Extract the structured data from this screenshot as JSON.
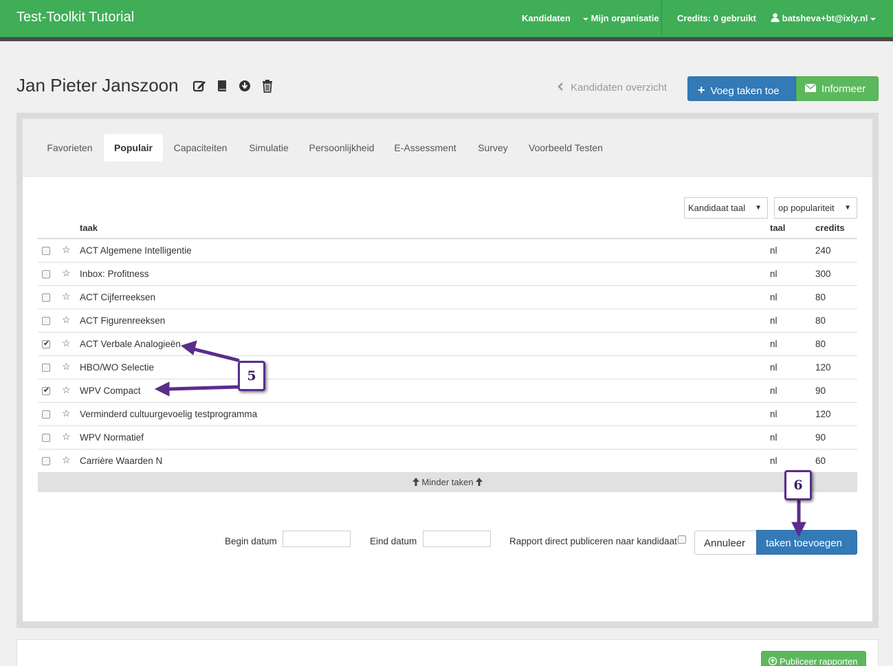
{
  "app": {
    "brand": "Test-Toolkit Tutorial",
    "nav": {
      "kandidaten": "Kandidaten",
      "organisatie": "Mijn organisatie",
      "credits": "Credits: 0 gebruikt",
      "user": "batsheva+bt@ixly.nl"
    }
  },
  "header": {
    "title": "Jan Pieter Janszoon",
    "icons": [
      "edit-icon",
      "book-icon",
      "download-icon",
      "trash-icon"
    ],
    "back_link": "Kandidaten overzicht",
    "add_tasks_button": "Voeg taken toe",
    "inform_button": "Informeer"
  },
  "tabs": [
    {
      "label": "Favorieten",
      "active": false
    },
    {
      "label": "Populair",
      "active": true
    },
    {
      "label": "Capaciteiten",
      "active": false
    },
    {
      "label": "Simulatie",
      "active": false
    },
    {
      "label": "Persoonlijkheid",
      "active": false
    },
    {
      "label": "E-Assessment",
      "active": false
    },
    {
      "label": "Survey",
      "active": false
    },
    {
      "label": "Voorbeeld Testen",
      "active": false
    }
  ],
  "filters": {
    "language": "Kandidaat taal",
    "sort": "op populariteit"
  },
  "table": {
    "columns": {
      "task": "taak",
      "lang": "taal",
      "credits": "credits"
    },
    "rows": [
      {
        "name": "ACT Algemene Intelligentie",
        "lang": "nl",
        "credits": "240",
        "checked": false
      },
      {
        "name": "Inbox: Profitness",
        "lang": "nl",
        "credits": "300",
        "checked": false
      },
      {
        "name": "ACT Cijferreeksen",
        "lang": "nl",
        "credits": "80",
        "checked": false
      },
      {
        "name": "ACT Figurenreeksen",
        "lang": "nl",
        "credits": "80",
        "checked": false
      },
      {
        "name": "ACT Verbale Analogieën",
        "lang": "nl",
        "credits": "80",
        "checked": true
      },
      {
        "name": "HBO/WO Selectie",
        "lang": "nl",
        "credits": "120",
        "checked": false
      },
      {
        "name": "WPV Compact",
        "lang": "nl",
        "credits": "90",
        "checked": true
      },
      {
        "name": "Verminderd cultuurgevoelig testprogramma",
        "lang": "nl",
        "credits": "120",
        "checked": false
      },
      {
        "name": "WPV Normatief",
        "lang": "nl",
        "credits": "90",
        "checked": false
      },
      {
        "name": "Carrière Waarden N",
        "lang": "nl",
        "credits": "60",
        "checked": false
      }
    ],
    "less_tasks": "Minder taken"
  },
  "footer_form": {
    "begin_label": "Begin datum",
    "begin_value": "",
    "end_label": "Eind datum",
    "end_value": "",
    "publish_label": "Rapport direct publiceren naar kandidaat",
    "publish_checked": false,
    "cancel_button": "Annuleer",
    "add_button": "taken toevoegen"
  },
  "annotations": {
    "step_5": "5",
    "step_6": "6",
    "color": "#5a2d8c"
  },
  "bottom": {
    "publish_reports_button": "Publiceer rapporten"
  },
  "colors": {
    "brand_green": "#3fae57",
    "primary_blue": "#337ab7",
    "success_green": "#5cb85c"
  }
}
